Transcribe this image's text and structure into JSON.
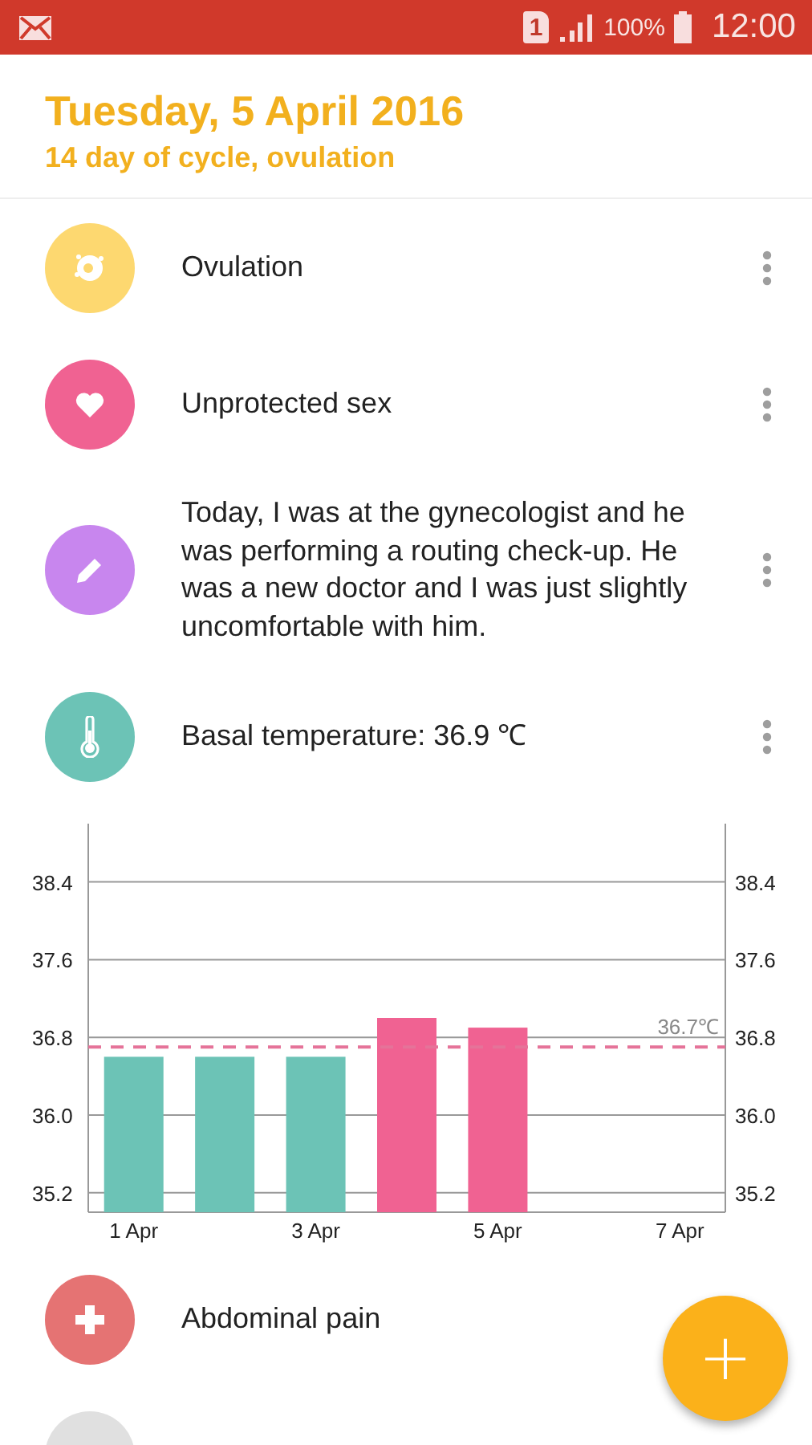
{
  "status_bar": {
    "sim": "1",
    "battery": "100%",
    "time": "12:00"
  },
  "header": {
    "date": "Tuesday, 5 April 2016",
    "subtitle": "14 day of cycle, ovulation"
  },
  "entries": [
    {
      "kind": "ovulation",
      "color": "#fdd870",
      "label": "Ovulation",
      "menu": true
    },
    {
      "kind": "heart",
      "color": "#f06292",
      "label": "Unprotected sex",
      "menu": true
    },
    {
      "kind": "note",
      "color": "#c886ee",
      "label": "Today, I was at the gynecologist and he was performing a routing check-up. He was a new doctor and I was just slightly uncomfortable  with him.",
      "menu": true
    },
    {
      "kind": "temperature",
      "color": "#6cc3b6",
      "label": "Basal temperature: 36.9 ℃",
      "menu": true
    }
  ],
  "chart_data": {
    "type": "bar",
    "categories": [
      "1 Apr",
      null,
      "3 Apr",
      null,
      "5 Apr",
      null,
      "7 Apr"
    ],
    "series": [
      {
        "color": "#6cc3b6",
        "values": [
          36.6,
          36.6,
          36.6,
          null,
          null,
          null,
          null
        ]
      },
      {
        "color": "#f06292",
        "values": [
          null,
          null,
          null,
          37.0,
          36.9,
          null,
          null
        ]
      }
    ],
    "stacked": true,
    "grid": true,
    "ylim": [
      35.0,
      39.0
    ],
    "y2lim": [
      35.0,
      39.0
    ],
    "yticks": [
      {
        "value": 35.2,
        "label": "35.2"
      },
      {
        "value": 36.0,
        "label": "36.0"
      },
      {
        "value": 36.8,
        "label": "36.8"
      },
      {
        "value": 37.6,
        "label": "37.6"
      },
      {
        "value": 38.4,
        "label": "38.4"
      }
    ],
    "y2ticks": [
      {
        "value": 35.2,
        "label": "35.2"
      },
      {
        "value": 36.0,
        "label": "36.0"
      },
      {
        "value": 36.8,
        "label": "36.8"
      },
      {
        "value": 37.6,
        "label": "37.6"
      },
      {
        "value": 38.4,
        "label": "38.4"
      }
    ],
    "ref_lines": [
      {
        "axis": "y",
        "value": 36.7,
        "label": "36.7℃",
        "color": "#e57399"
      }
    ]
  },
  "more_entries": [
    {
      "kind": "cross",
      "color": "#e57373",
      "label": "Abdominal pain",
      "menu": false
    },
    {
      "kind": "blank",
      "color": "#e0e0e0",
      "menu": false
    }
  ],
  "fab": {
    "label": "+"
  }
}
